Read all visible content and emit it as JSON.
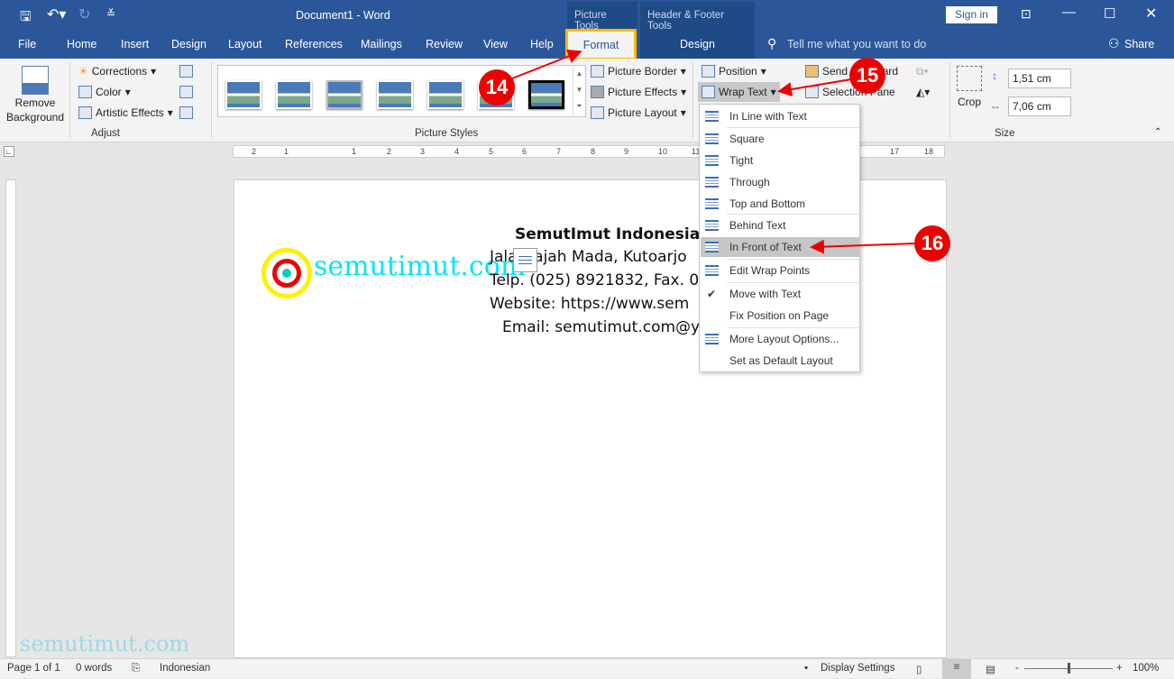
{
  "window": {
    "title": "Document1  -  Word",
    "contextual_1": "Picture Tools",
    "contextual_2": "Header & Footer Tools",
    "sign_in": "Sign in"
  },
  "tabs": [
    "File",
    "Home",
    "Insert",
    "Design",
    "Layout",
    "References",
    "Mailings",
    "Review",
    "View",
    "Help",
    "Format",
    "Design"
  ],
  "tell_me": "Tell me what you want to do",
  "share": "Share",
  "ribbon": {
    "remove_bg": "Remove Background",
    "corrections": "Corrections",
    "color": "Color",
    "artistic": "Artistic Effects",
    "adjust": "Adjust",
    "picture_styles": "Picture Styles",
    "picture_border": "Picture Border",
    "picture_effects": "Picture Effects",
    "picture_layout": "Picture Layout",
    "position": "Position",
    "wrap_text": "Wrap Text",
    "send_backward": "Send Backward",
    "selection_pane": "Selection Pane",
    "crop": "Crop",
    "height": "1,51 cm",
    "width": "7,06 cm",
    "size": "Size"
  },
  "ruler": [
    "2",
    "1",
    "1",
    "2",
    "3",
    "4",
    "5",
    "6",
    "7",
    "8",
    "9",
    "10",
    "11",
    "17",
    "18"
  ],
  "document": {
    "logo": "semutimut.com",
    "lines": [
      "SemutImut Indonesia T",
      "Jala  Gajah Mada, Kutoarjo",
      "Telp. (025) 8921832, Fax. 0",
      "Website: https://www.sem",
      "Email: semutimut.com@y"
    ]
  },
  "wrap_menu": [
    "In Line with Text",
    "Square",
    "Tight",
    "Through",
    "Top and Bottom",
    "Behind Text",
    "In Front of Text",
    "Edit Wrap Points",
    "Move with Text",
    "Fix Position on Page",
    "More Layout Options...",
    "Set as Default Layout"
  ],
  "annotations": [
    "14",
    "15",
    "16"
  ],
  "watermark": "semutimut.com",
  "status": {
    "page": "Page 1 of 1",
    "words": "0 words",
    "language": "Indonesian",
    "display": "Display Settings",
    "zoom": "100%",
    "zoom_level": 100
  },
  "colors": {
    "brand": "#2b579a",
    "highlight": "#ffb900",
    "annotation": "#e00000"
  }
}
